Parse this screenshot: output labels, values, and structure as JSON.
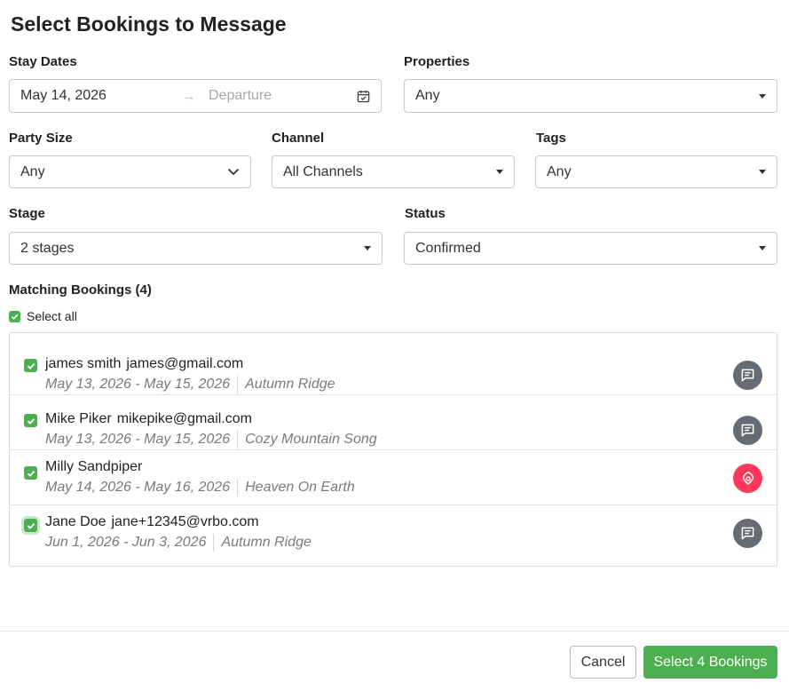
{
  "dialog": {
    "title": "Select Bookings to Message"
  },
  "filters": {
    "stay_dates": {
      "label": "Stay Dates",
      "start": "May 14, 2026",
      "arrow": "→",
      "end_placeholder": "Departure"
    },
    "properties": {
      "label": "Properties",
      "value": "Any"
    },
    "party_size": {
      "label": "Party Size",
      "value": "Any"
    },
    "channel": {
      "label": "Channel",
      "value": "All Channels"
    },
    "tags": {
      "label": "Tags",
      "value": "Any"
    },
    "stage": {
      "label": "Stage",
      "value": "2 stages"
    },
    "status": {
      "label": "Status",
      "value": "Confirmed"
    }
  },
  "matching": {
    "heading": "Matching Bookings (4)",
    "select_all_label": "Select all",
    "bookings": [
      {
        "name": "james smith",
        "email": "james@gmail.com",
        "dates": "May 13, 2026 - May 15, 2026",
        "property": "Autumn Ridge",
        "channel_icon": "message-icon"
      },
      {
        "name": "Mike Piker",
        "email": "mikepike@gmail.com",
        "dates": "May 13, 2026 - May 15, 2026",
        "property": "Cozy Mountain Song",
        "channel_icon": "message-icon"
      },
      {
        "name": "Milly Sandpiper",
        "email": "",
        "dates": "May 14, 2026 - May 16, 2026",
        "property": "Heaven On Earth",
        "channel_icon": "airbnb-icon"
      },
      {
        "name": "Jane Doe",
        "email": "jane+12345@vrbo.com",
        "dates": "Jun 1, 2026 - Jun 3, 2026",
        "property": "Autumn Ridge",
        "channel_icon": "message-icon"
      }
    ]
  },
  "footer": {
    "cancel_label": "Cancel",
    "primary_label": "Select 4 Bookings"
  },
  "colors": {
    "accent": "#4caf50",
    "airbnb": "#ff385c",
    "message_icon_bg": "#656c73"
  }
}
